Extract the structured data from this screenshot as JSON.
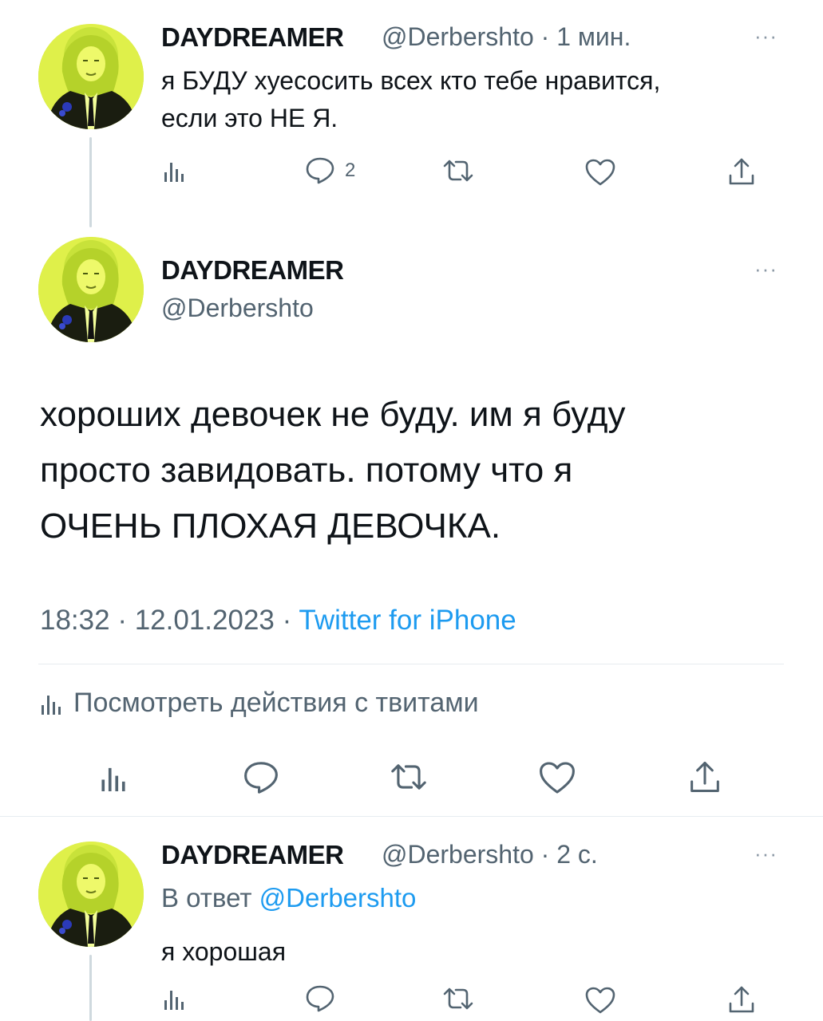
{
  "colors": {
    "link": "#1d9bf0",
    "muted": "#536471",
    "avatar_bg": "#dff04a"
  },
  "tweet1": {
    "display_name": "DAYDREAMER",
    "handle": "@Derbershto",
    "separator": "·",
    "time": "1 мин.",
    "text_line1": "я БУДУ хуесосить всех кто тебе нравится,",
    "text_line2": "если это НЕ Я.",
    "reply_count": "2",
    "icons": [
      "analytics-icon",
      "reply-icon",
      "retweet-icon",
      "like-icon",
      "share-icon"
    ]
  },
  "main_tweet": {
    "display_name": "DAYDREAMER",
    "handle": "@Derbershto",
    "text_line1": "хороших девочек не буду. им я буду",
    "text_line2": "просто завидовать. потому что я",
    "text_line3": "ОЧЕНЬ ПЛОХАЯ ДЕВОЧКА.",
    "time": "18:32",
    "date": "12.01.2023",
    "source": "Twitter for iPhone",
    "separator": "·",
    "activity_label": "Посмотреть действия с твитами"
  },
  "reply": {
    "display_name": "DAYDREAMER",
    "handle": "@Derbershto",
    "separator": "·",
    "time": "2 с.",
    "reply_to_label": "В ответ",
    "reply_to_handle": "@Derbershto",
    "text": "я хорошая"
  },
  "more_glyph": "···"
}
